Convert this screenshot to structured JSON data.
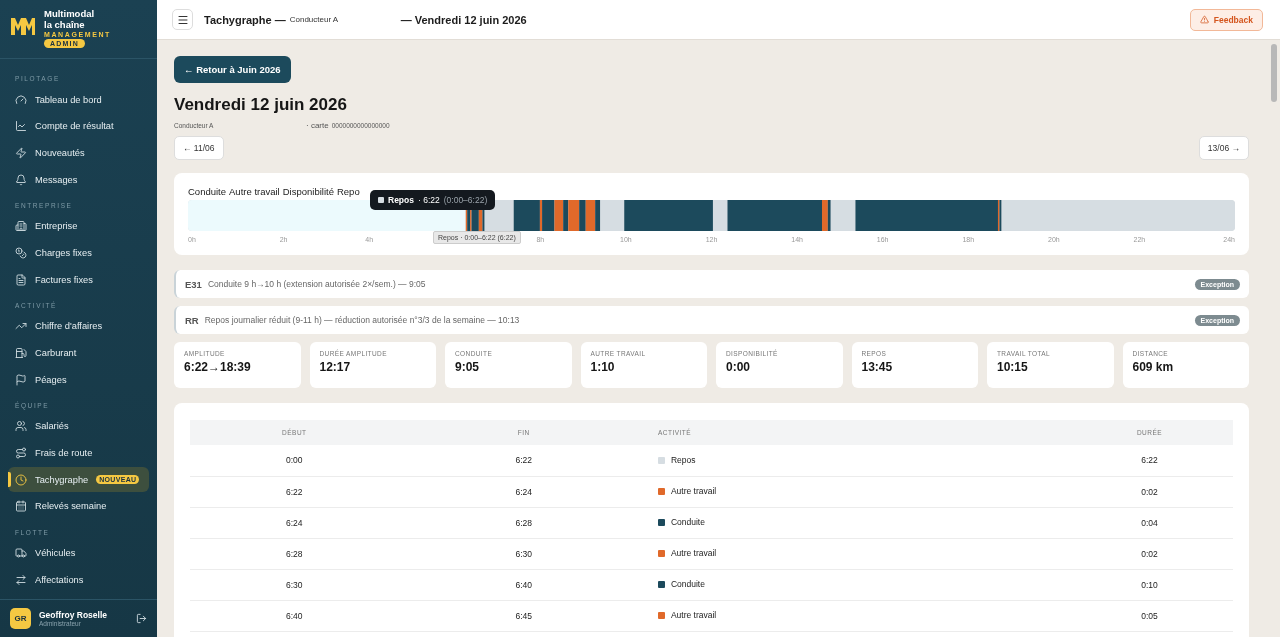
{
  "brand": {
    "line1": "Multimodal",
    "line2": "la chaîne",
    "line3": "MANAGEMENT",
    "badge": "ADMIN"
  },
  "sidebar": {
    "sections": [
      {
        "title": "PILOTAGE",
        "items": [
          {
            "label": "Tableau de bord",
            "selected": false
          },
          {
            "label": "Compte de résultat",
            "selected": false
          },
          {
            "label": "Nouveautés",
            "selected": false
          },
          {
            "label": "Messages",
            "selected": false
          }
        ]
      },
      {
        "title": "ENTREPRISE",
        "items": [
          {
            "label": "Entreprise",
            "selected": false
          },
          {
            "label": "Charges fixes",
            "selected": false
          },
          {
            "label": "Factures fixes",
            "selected": false
          }
        ]
      },
      {
        "title": "ACTIVITÉ",
        "items": [
          {
            "label": "Chiffre d'affaires",
            "selected": false
          },
          {
            "label": "Carburant",
            "selected": false
          },
          {
            "label": "Péages",
            "selected": false
          }
        ]
      },
      {
        "title": "ÉQUIPE",
        "items": [
          {
            "label": "Salariés",
            "selected": false
          },
          {
            "label": "Frais de route",
            "selected": false
          },
          {
            "label": "Tachygraphe",
            "selected": true,
            "badge": "NOUVEAU"
          },
          {
            "label": "Relevés semaine",
            "selected": false
          }
        ]
      },
      {
        "title": "FLOTTE",
        "items": [
          {
            "label": "Véhicules",
            "selected": false
          },
          {
            "label": "Affectations",
            "selected": false
          }
        ]
      }
    ],
    "user": {
      "initials": "GR",
      "name": "Geoffroy Roselle",
      "role": "Administrateur"
    }
  },
  "header": {
    "title": "Tachygraphe —",
    "subtitle": "Conducteur A",
    "date": "— Vendredi 12 juin 2026",
    "feedback": "Feedback"
  },
  "back_button": "← Retour à Juin 2026",
  "page_title": "Vendredi 12 juin 2026",
  "driver": "Conducteur A",
  "card_label": "· carte",
  "card_number": "0000000000000000",
  "prev_day": "← 11/06",
  "next_day": "13/06 →",
  "timeline": {
    "legend": [
      "Conduite",
      "Autre travail",
      "Disponibilité",
      "Repo"
    ],
    "tooltip": {
      "kind": "repos",
      "label": "Repos",
      "text": "· 6:22",
      "range": "(0:00–6:22)"
    },
    "hover_label": "Repos · 0:00–6:22 (6:22)",
    "ticks": [
      "0h",
      "2h",
      "4h",
      "8h",
      "10h",
      "12h",
      "14h",
      "16h",
      "18h",
      "20h",
      "22h",
      "24h"
    ]
  },
  "alerts": [
    {
      "code": "E31",
      "text": "Conduite 9 h→10 h (extension autorisée 2×/sem.) — 9:05",
      "badge": "Exception"
    },
    {
      "code": "RR",
      "text": "Repos journalier réduit (9-11 h) — réduction autorisée n°3/3 de la semaine — 10:13",
      "badge": "Exception"
    }
  ],
  "stats": [
    {
      "label": "AMPLITUDE",
      "value": "6:22→18:39"
    },
    {
      "label": "DURÉE AMPLITUDE",
      "value": "12:17"
    },
    {
      "label": "CONDUITE",
      "value": "9:05"
    },
    {
      "label": "AUTRE TRAVAIL",
      "value": "1:10"
    },
    {
      "label": "DISPONIBILITÉ",
      "value": "0:00"
    },
    {
      "label": "REPOS",
      "value": "13:45"
    },
    {
      "label": "TRAVAIL TOTAL",
      "value": "10:15"
    },
    {
      "label": "DISTANCE",
      "value": "609 km"
    }
  ],
  "table": {
    "columns": [
      "DÉBUT",
      "FIN",
      "ACTIVITÉ",
      "DURÉE"
    ],
    "rows": [
      {
        "start": "0:00",
        "end": "6:22",
        "kind": "repos",
        "activity": "Repos",
        "duration": "6:22"
      },
      {
        "start": "6:22",
        "end": "6:24",
        "kind": "autre",
        "activity": "Autre travail",
        "duration": "0:02"
      },
      {
        "start": "6:24",
        "end": "6:28",
        "kind": "conduite",
        "activity": "Conduite",
        "duration": "0:04"
      },
      {
        "start": "6:28",
        "end": "6:30",
        "kind": "autre",
        "activity": "Autre travail",
        "duration": "0:02"
      },
      {
        "start": "6:30",
        "end": "6:40",
        "kind": "conduite",
        "activity": "Conduite",
        "duration": "0:10"
      },
      {
        "start": "6:40",
        "end": "6:45",
        "kind": "autre",
        "activity": "Autre travail",
        "duration": "0:05"
      }
    ]
  }
}
